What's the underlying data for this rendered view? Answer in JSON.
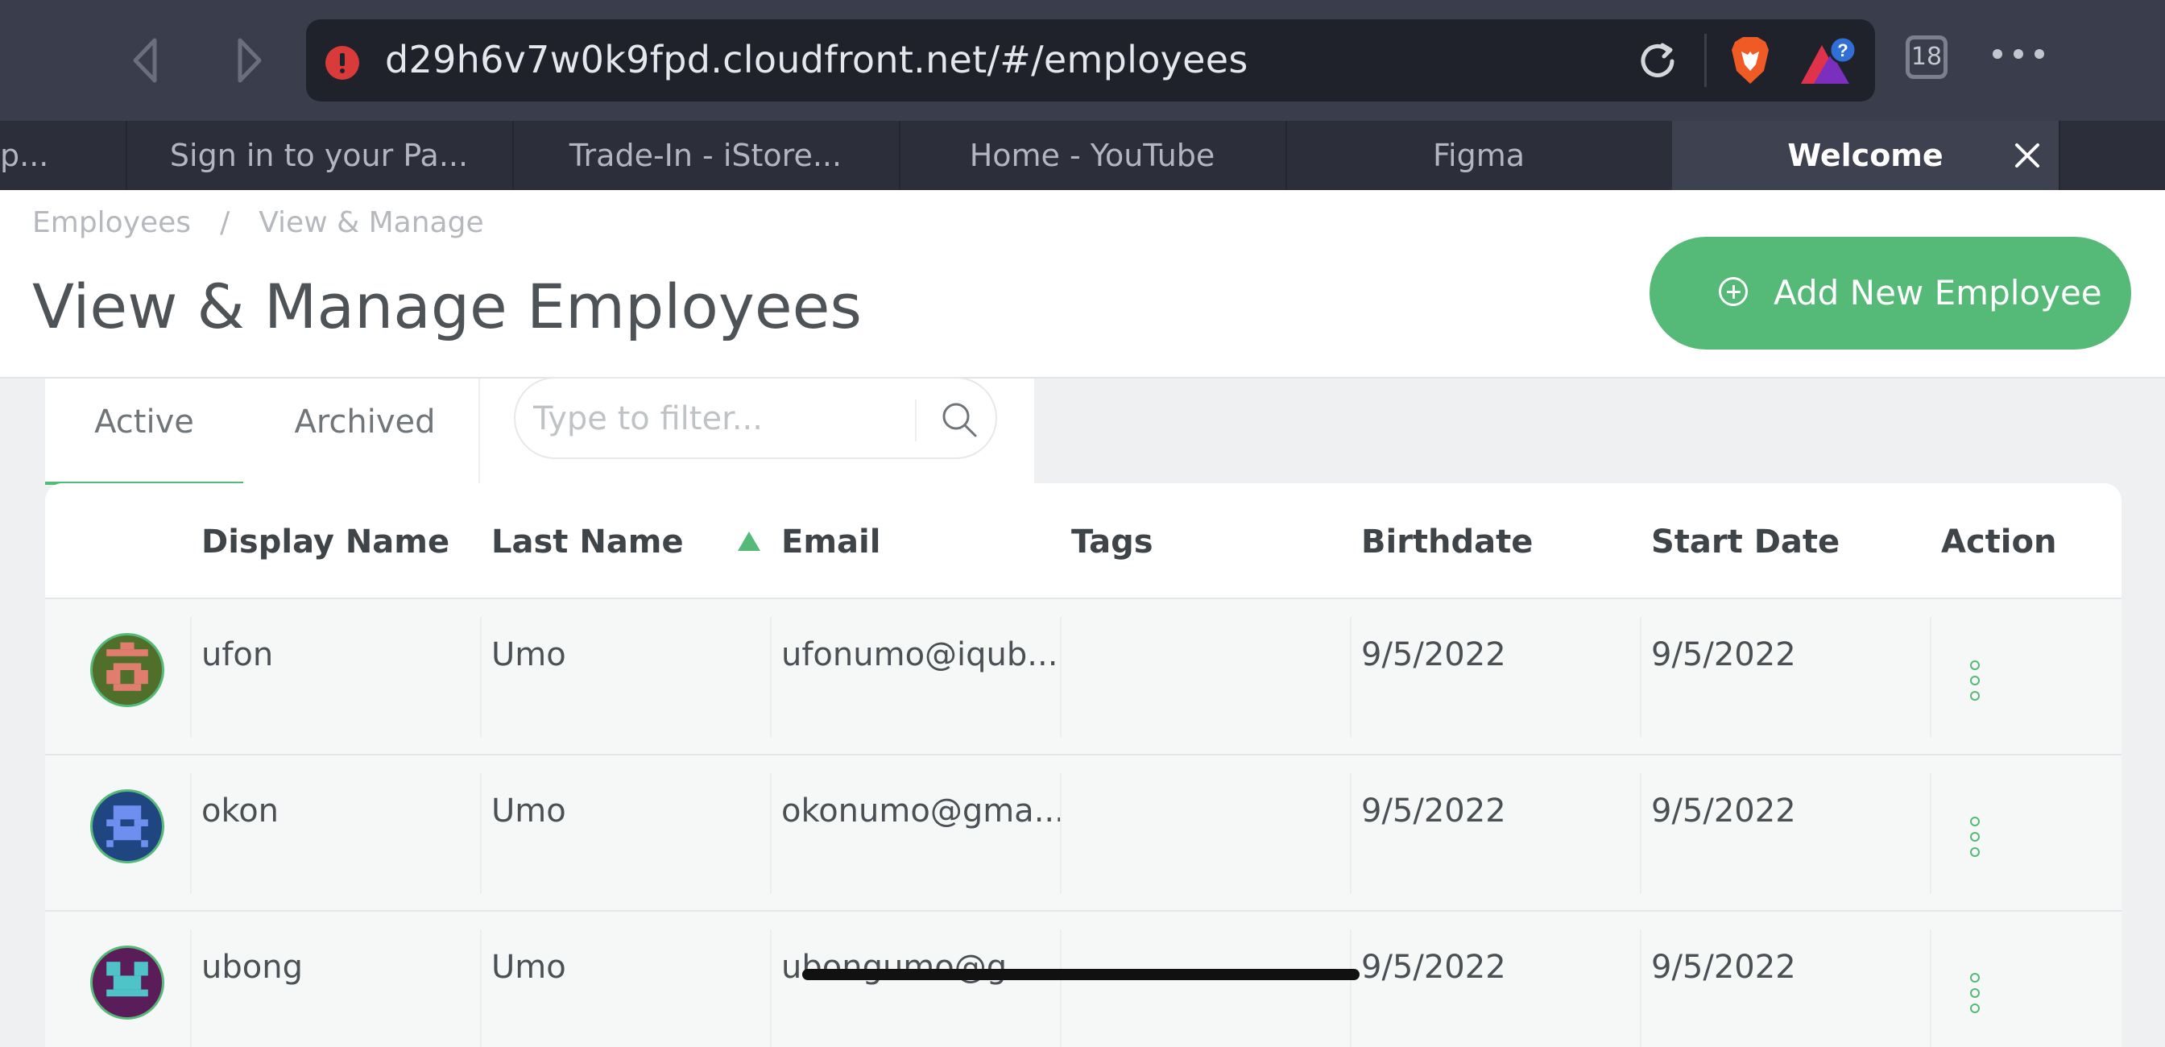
{
  "browser": {
    "url": "d29h6v7w0k9fpd.cloudfront.net/#/employees",
    "tab_count": "18",
    "tabs": [
      {
        "label": "p..."
      },
      {
        "label": "Sign in to your Pa..."
      },
      {
        "label": "Trade-In - iStore..."
      },
      {
        "label": "Home - YouTube"
      },
      {
        "label": "Figma"
      },
      {
        "label": "Welcome",
        "active": true
      }
    ]
  },
  "breadcrumb": {
    "parent": "Employees",
    "separator": "/",
    "current": "View & Manage"
  },
  "page": {
    "title": "View & Manage Employees",
    "add_button_label": "Add New Employee"
  },
  "filter": {
    "tabs": [
      "Active",
      "Archived"
    ],
    "active_tab": "Active",
    "search_placeholder": "Type to filter..."
  },
  "table": {
    "columns": [
      "Display Name",
      "Last Name",
      "Email",
      "Tags",
      "Birthdate",
      "Start Date",
      "Action"
    ],
    "sorted_column": "Email",
    "sort_direction": "ascending",
    "rows": [
      {
        "display_name": "ufon",
        "last_name": "Umo",
        "email": "ufonumo@iqub...",
        "tags": "",
        "birthdate": "9/5/2022",
        "start_date": "9/5/2022",
        "avatar_color": "#e07d6f",
        "avatar_bg": "#4f6f2a"
      },
      {
        "display_name": "okon",
        "last_name": "Umo",
        "email": "okonumo@gma...",
        "tags": "",
        "birthdate": "9/5/2022",
        "start_date": "9/5/2022",
        "avatar_color": "#6f8ff0",
        "avatar_bg": "#1f4680"
      },
      {
        "display_name": "ubong",
        "last_name": "Umo",
        "email": "ubongumo@g...",
        "tags": "",
        "birthdate": "9/5/2022",
        "start_date": "9/5/2022",
        "avatar_color": "#4ec3c8",
        "avatar_bg": "#5a1d5a"
      }
    ]
  },
  "colors": {
    "accent": "#55b978",
    "chrome_bg": "#3a3d4c",
    "warning": "#d93a3a"
  }
}
